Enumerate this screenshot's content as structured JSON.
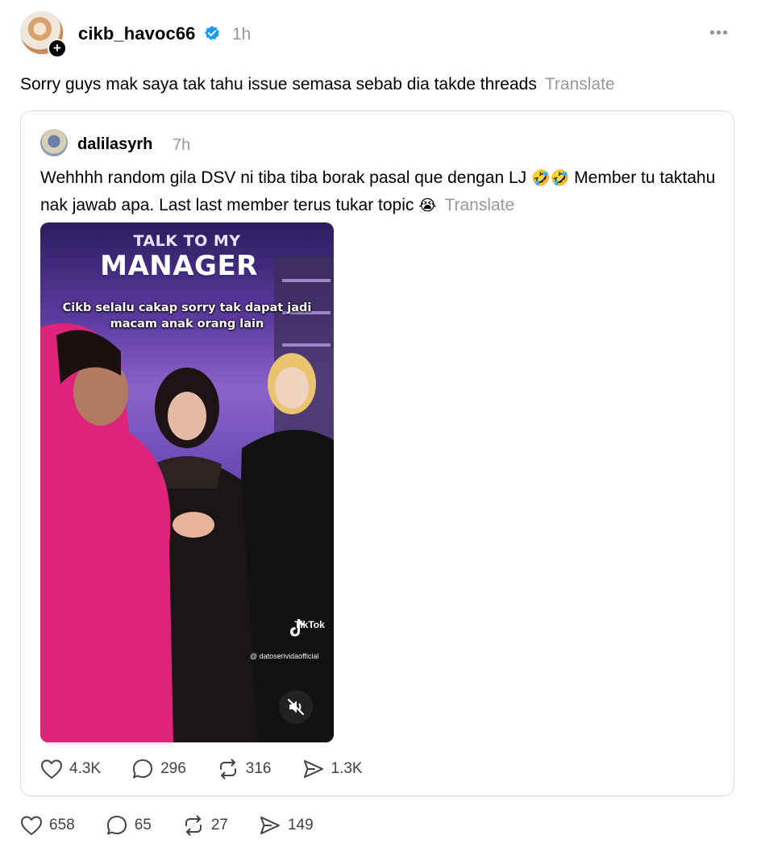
{
  "post": {
    "username": "cikb_havoc66",
    "time": "1h",
    "more_label": "•••",
    "follow_badge": "+",
    "text": "Sorry guys mak saya tak tahu issue semasa sebab dia takde threads",
    "translate_label": "Translate",
    "actions": {
      "likes": "658",
      "replies": "65",
      "reposts": "27",
      "shares": "149"
    }
  },
  "quoted_post": {
    "username": "dalilasyrh",
    "time": "7h",
    "text_part1": "Wehhhh random gila DSV ni tiba tiba borak pasal que dengan LJ ",
    "emoji1": "🤣🤣",
    "text_part2": " Member tu taktahu nak jawab apa. Last last member terus tukar topic ",
    "emoji2": "😭",
    "translate_label": "Translate",
    "video": {
      "logo_line1": "TALK TO MY",
      "logo_line2": "MANAGER",
      "caption": "Cikb selalu cakap sorry tak dapat jadi macam anak orang lain",
      "tiktok_label": "TikTok",
      "handle": "@ datoserividaofficial"
    },
    "actions": {
      "likes": "4.3K",
      "replies": "296",
      "reposts": "316",
      "shares": "1.3K"
    }
  },
  "colors": {
    "verified": "#1d9bf0",
    "muted_text": "#999999",
    "border": "#dcdcdc"
  }
}
